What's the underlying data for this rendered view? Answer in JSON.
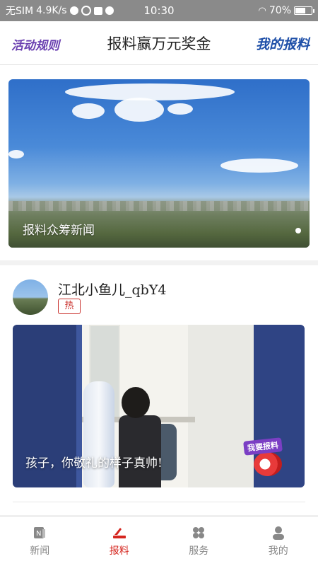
{
  "status_bar": {
    "carrier": "无SIM",
    "speed": "4.9K/s",
    "time": "10:30",
    "battery": "70%",
    "battery_level": 0.7
  },
  "header": {
    "left_link": "活动规则",
    "title": "报料赢万元奖金",
    "right_link": "我的报料"
  },
  "banner": {
    "caption": "报料众筹新闻",
    "page_dots": 1
  },
  "post": {
    "username": "江北小鱼儿_qbY4",
    "badge": "热",
    "caption": "孩子，你敬礼的样子真帅!",
    "sticker_label": "我要报料"
  },
  "tabbar": {
    "tabs": [
      {
        "label": "新闻",
        "icon": "news-icon",
        "active": false
      },
      {
        "label": "报料",
        "icon": "report-icon",
        "active": true
      },
      {
        "label": "服务",
        "icon": "services-icon",
        "active": false
      },
      {
        "label": "我的",
        "icon": "profile-icon",
        "active": false
      }
    ]
  },
  "colors": {
    "accent": "#d5261f",
    "header_left": "#6a3fb0",
    "header_right": "#1e4fa8"
  }
}
